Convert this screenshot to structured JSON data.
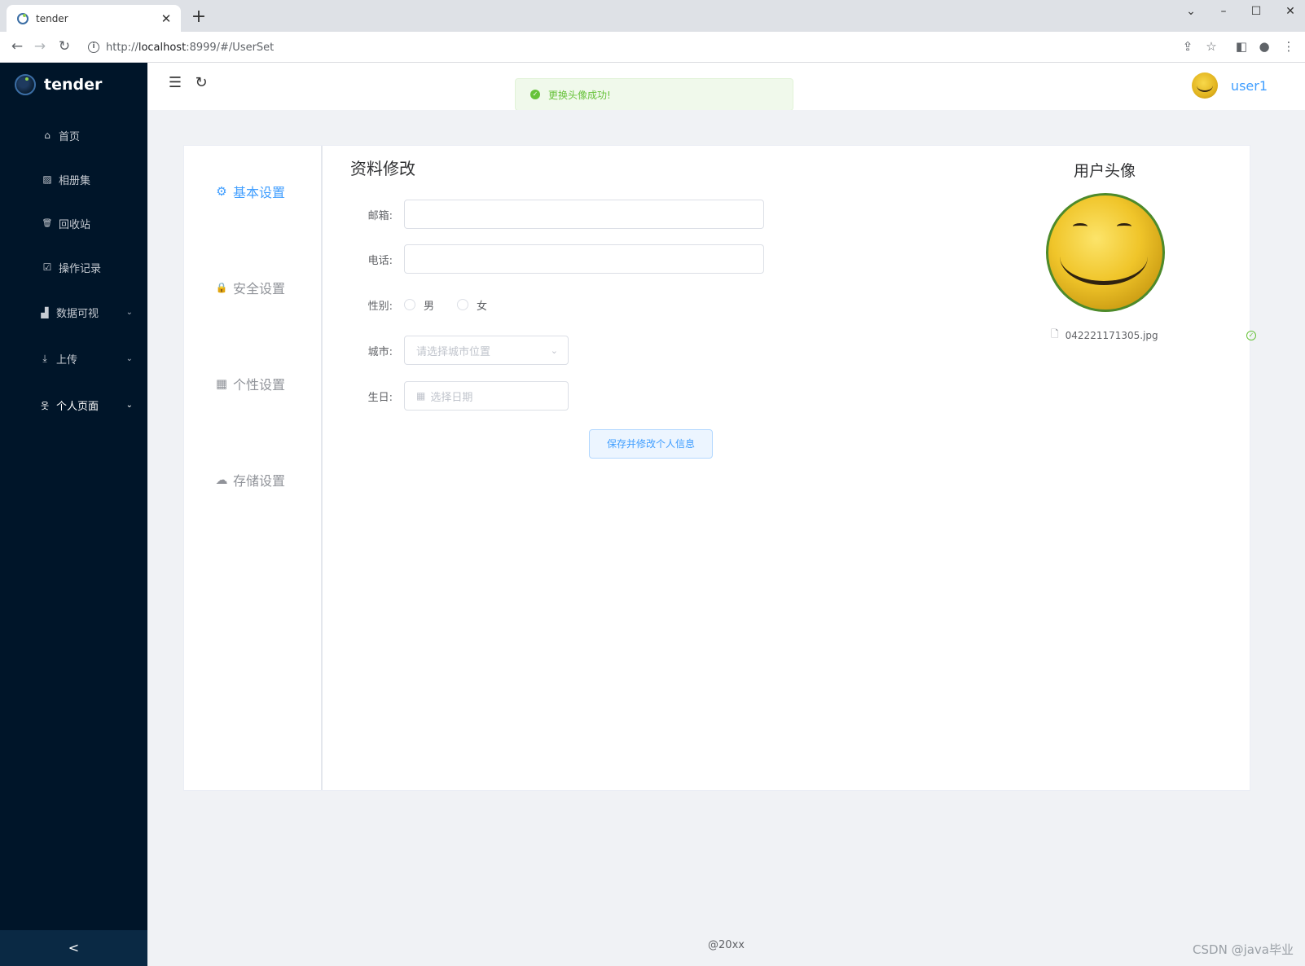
{
  "browser": {
    "tab_title": "tender",
    "tab_close": "✕",
    "new_tab": "+",
    "url_prefix": "http://",
    "url_host": "localhost",
    "url_rest": ":8999/#/UserSet"
  },
  "sidebar": {
    "brand": "tender",
    "items": [
      {
        "label": "首页",
        "icon": "home-icon",
        "glyph": "⌂"
      },
      {
        "label": "相册集",
        "icon": "picture-icon",
        "glyph": "▨"
      },
      {
        "label": "回收站",
        "icon": "trash-icon",
        "glyph": "🗑"
      },
      {
        "label": "操作记录",
        "icon": "calendar-check-icon",
        "glyph": "☑"
      },
      {
        "label": "数据可视",
        "icon": "chart-icon",
        "glyph": "▟",
        "expandable": true
      },
      {
        "label": "上传",
        "icon": "upload-icon",
        "glyph": "⤓",
        "expandable": true
      },
      {
        "label": "个人页面",
        "icon": "user-icon",
        "glyph": "웃",
        "expandable": true,
        "active": true
      }
    ],
    "collapse_label": "<"
  },
  "header": {
    "username": "user1",
    "toast": "更换头像成功!"
  },
  "settings_nav": {
    "items": [
      {
        "label": "基本设置",
        "icon": "gear-icon",
        "glyph": "⚙",
        "active": true
      },
      {
        "label": "安全设置",
        "icon": "lock-icon",
        "glyph": "🔒"
      },
      {
        "label": "个性设置",
        "icon": "grid-icon",
        "glyph": "▦"
      },
      {
        "label": "存储设置",
        "icon": "cloud-icon",
        "glyph": "☁"
      }
    ]
  },
  "form": {
    "title": "资料修改",
    "email_label": "邮箱:",
    "email_value": "",
    "phone_label": "电话:",
    "phone_value": "",
    "gender_label": "性别:",
    "gender_male": "男",
    "gender_female": "女",
    "city_label": "城市:",
    "city_placeholder": "请选择城市位置",
    "birthday_label": "生日:",
    "birthday_placeholder": "选择日期",
    "save_label": "保存并修改个人信息"
  },
  "avatar": {
    "title": "用户头像",
    "file_name": "042221171305.jpg"
  },
  "footer": {
    "text": "@20xx",
    "watermark": "CSDN @java毕业"
  },
  "colors": {
    "sidebar_bg": "#001529",
    "accent": "#409eff",
    "success": "#67c23a"
  }
}
